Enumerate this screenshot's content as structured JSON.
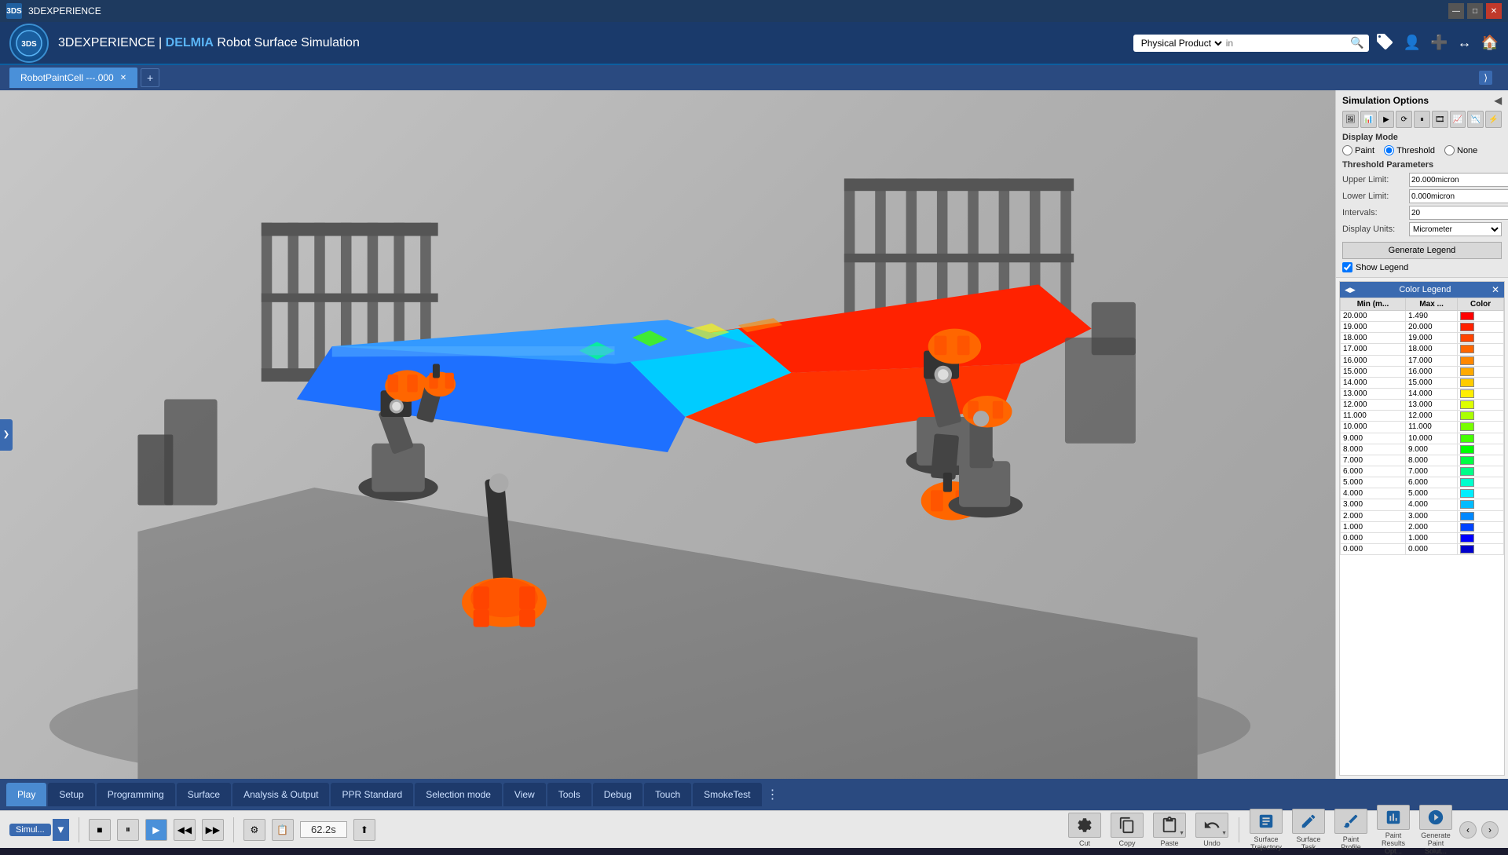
{
  "titleBar": {
    "appName": "3DEXPERIENCE",
    "minBtn": "—",
    "maxBtn": "□",
    "closeBtn": "✕"
  },
  "header": {
    "logoText": "3DS",
    "appTitle": "3DEXPERIENCE | DELMIA Robot Surface Simulation",
    "delmia": "DELMIA",
    "subtitle": "Robot Surface Simulation",
    "searchPlaceholder": "in",
    "searchType": "Physical Product"
  },
  "tabBar": {
    "tabs": [
      {
        "label": "RobotPaintCell ---.000",
        "active": true
      }
    ],
    "addLabel": "+"
  },
  "simulationOptions": {
    "title": "Simulation Options",
    "displayMode": {
      "label": "Display Mode",
      "options": [
        "Paint",
        "Threshold",
        "None"
      ],
      "selected": "Threshold"
    },
    "thresholdParams": {
      "label": "Threshold Parameters",
      "upperLimit": {
        "label": "Upper Limit:",
        "value": "20.000micron"
      },
      "lowerLimit": {
        "label": "Lower Limit:",
        "value": "0.000micron"
      },
      "intervals": {
        "label": "Intervals:",
        "value": "20"
      },
      "displayUnits": {
        "label": "Display Units:",
        "value": "Micrometer"
      }
    },
    "generateLegendBtn": "Generate Legend",
    "showLegend": {
      "label": "Show Legend",
      "checked": true
    }
  },
  "colorLegend": {
    "title": "Color Legend",
    "columns": [
      "Min (m...",
      "Max ...",
      "Color"
    ],
    "rows": [
      {
        "min": "20.000",
        "max": "1.490",
        "colorHex": "#ff0000"
      },
      {
        "min": "19.000",
        "max": "20.000",
        "colorHex": "#ff2200"
      },
      {
        "min": "18.000",
        "max": "19.000",
        "colorHex": "#ff4400"
      },
      {
        "min": "17.000",
        "max": "18.000",
        "colorHex": "#ff6600"
      },
      {
        "min": "16.000",
        "max": "17.000",
        "colorHex": "#ff8800"
      },
      {
        "min": "15.000",
        "max": "16.000",
        "colorHex": "#ffaa00"
      },
      {
        "min": "14.000",
        "max": "15.000",
        "colorHex": "#ffcc00"
      },
      {
        "min": "13.000",
        "max": "14.000",
        "colorHex": "#ffee00"
      },
      {
        "min": "12.000",
        "max": "13.000",
        "colorHex": "#ddff00"
      },
      {
        "min": "11.000",
        "max": "12.000",
        "colorHex": "#aaff00"
      },
      {
        "min": "10.000",
        "max": "11.000",
        "colorHex": "#77ff00"
      },
      {
        "min": "9.000",
        "max": "10.000",
        "colorHex": "#44ff00"
      },
      {
        "min": "8.000",
        "max": "9.000",
        "colorHex": "#00ff00"
      },
      {
        "min": "7.000",
        "max": "8.000",
        "colorHex": "#00ff44"
      },
      {
        "min": "6.000",
        "max": "7.000",
        "colorHex": "#00ff88"
      },
      {
        "min": "5.000",
        "max": "6.000",
        "colorHex": "#00ffcc"
      },
      {
        "min": "4.000",
        "max": "5.000",
        "colorHex": "#00eeff"
      },
      {
        "min": "3.000",
        "max": "4.000",
        "colorHex": "#00bbff"
      },
      {
        "min": "2.000",
        "max": "3.000",
        "colorHex": "#0088ff"
      },
      {
        "min": "1.000",
        "max": "2.000",
        "colorHex": "#0044ff"
      },
      {
        "min": "0.000",
        "max": "1.000",
        "colorHex": "#0000ff"
      },
      {
        "min": "0.000",
        "max": "0.000",
        "colorHex": "#0000cc"
      }
    ]
  },
  "bottomTabs": {
    "tabs": [
      {
        "label": "Play",
        "active": true
      },
      {
        "label": "Setup",
        "active": false
      },
      {
        "label": "Programming",
        "active": false
      },
      {
        "label": "Surface",
        "active": false
      },
      {
        "label": "Analysis & Output",
        "active": false
      },
      {
        "label": "PPR Standard",
        "active": false
      },
      {
        "label": "Selection mode",
        "active": false
      },
      {
        "label": "View",
        "active": false
      },
      {
        "label": "Tools",
        "active": false
      },
      {
        "label": "Debug",
        "active": false
      },
      {
        "label": "Touch",
        "active": false
      },
      {
        "label": "SmokeTest",
        "active": false
      }
    ]
  },
  "playToolbar": {
    "simLabel": "Simul...",
    "stopBtn": "■",
    "pauseBtn": "⏸",
    "playBtn": "▶",
    "rewindBtn": "◀◀",
    "forwardBtn": "▶▶",
    "settingsBtn": "⚙",
    "scriptBtn": "📋",
    "timeDisplay": "62.2s",
    "exportBtn": "⬆"
  },
  "rightToolbar": {
    "actions": [
      {
        "icon": "✂",
        "label": "Cut",
        "hasDropdown": false
      },
      {
        "icon": "📋",
        "label": "Copy",
        "hasDropdown": false
      },
      {
        "icon": "📌",
        "label": "Paste",
        "hasDropdown": true
      },
      {
        "icon": "↩",
        "label": "Undo",
        "hasDropdown": true
      },
      {
        "sep": true
      },
      {
        "icon": "〰",
        "label": "Surface\nTrajectory",
        "hasDropdown": false
      },
      {
        "icon": "📐",
        "label": "Surface\nTask",
        "hasDropdown": false
      },
      {
        "icon": "🎨",
        "label": "Paint\nProfile",
        "hasDropdown": false
      },
      {
        "icon": "🔧",
        "label": "Paint\nResults Opt...",
        "hasDropdown": false
      },
      {
        "icon": "⚙",
        "label": "Generate\nPaint Solut...",
        "hasDropdown": false
      }
    ]
  }
}
